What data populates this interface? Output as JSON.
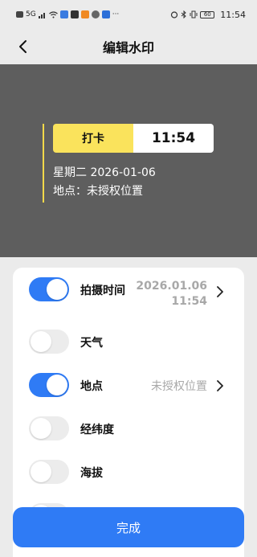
{
  "status_bar": {
    "left_icons": [
      "hd-icon",
      "signal-icon",
      "wifi-icon",
      "app-icon-blue",
      "app-icon-dark",
      "app-icon-orange",
      "app-icon-gray",
      "app-icon-blue2"
    ],
    "more": "···",
    "network": "5G",
    "battery": "60",
    "time": "11:54"
  },
  "header": {
    "title": "编辑水印",
    "back_icon": "chevron-left-icon"
  },
  "preview": {
    "tag": "打卡",
    "time": "11:54",
    "line1": "星期二 2026-01-06",
    "line2": "地点：未授权位置",
    "colors": {
      "background": "#5e5e5e",
      "tag_bg": "#fae35c",
      "accent_bar": "#f5d94a"
    }
  },
  "settings": {
    "rows": [
      {
        "label": "拍摄时间",
        "enabled": true,
        "value_line1": "2026.01.06",
        "value_line2": "11:54",
        "has_chevron": true
      },
      {
        "label": "天气",
        "enabled": false
      },
      {
        "label": "地点",
        "enabled": true,
        "value": "未授权位置",
        "has_chevron": true
      },
      {
        "label": "经纬度",
        "enabled": false
      },
      {
        "label": "海拔",
        "enabled": false
      }
    ]
  },
  "done_button": {
    "label": "完成",
    "color": "#2f7bf5"
  }
}
